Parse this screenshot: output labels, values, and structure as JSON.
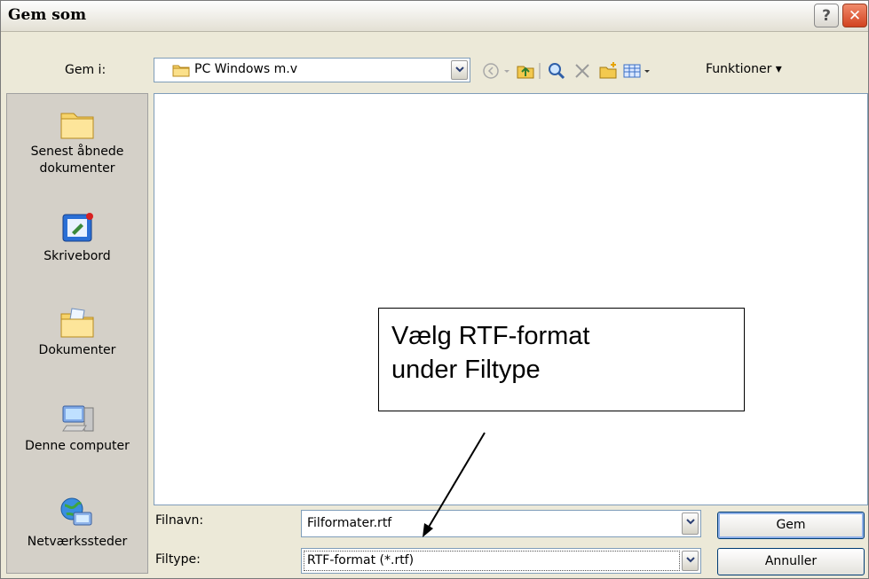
{
  "dialog": {
    "title": "Gem som",
    "help_glyph": "?",
    "close_glyph": "✕"
  },
  "save_in": {
    "label": "Gem i:",
    "value": "PC Windows m.v"
  },
  "toolbar": {
    "icons": [
      "back-icon",
      "up-folder-icon",
      "search-web-icon",
      "delete-icon",
      "new-folder-icon",
      "views-icon"
    ],
    "functions_label": "Funktioner ▾"
  },
  "places": [
    {
      "label": "Senest åbnede dokumenter",
      "icon": "recent-documents-icon"
    },
    {
      "label": "Skrivebord",
      "icon": "desktop-icon"
    },
    {
      "label": "Dokumenter",
      "icon": "my-documents-icon"
    },
    {
      "label": "Denne computer",
      "icon": "my-computer-icon"
    },
    {
      "label": "Netværkssteder",
      "icon": "network-places-icon"
    }
  ],
  "filename": {
    "label": "Filnavn:",
    "value": "Filformater.rtf"
  },
  "filetype": {
    "label": "Filtype:",
    "value": "RTF-format (*.rtf)"
  },
  "buttons": {
    "save": "Gem",
    "cancel": "Annuller"
  },
  "callout": {
    "line1": "Vælg RTF-format",
    "line2": "under Filtype"
  }
}
